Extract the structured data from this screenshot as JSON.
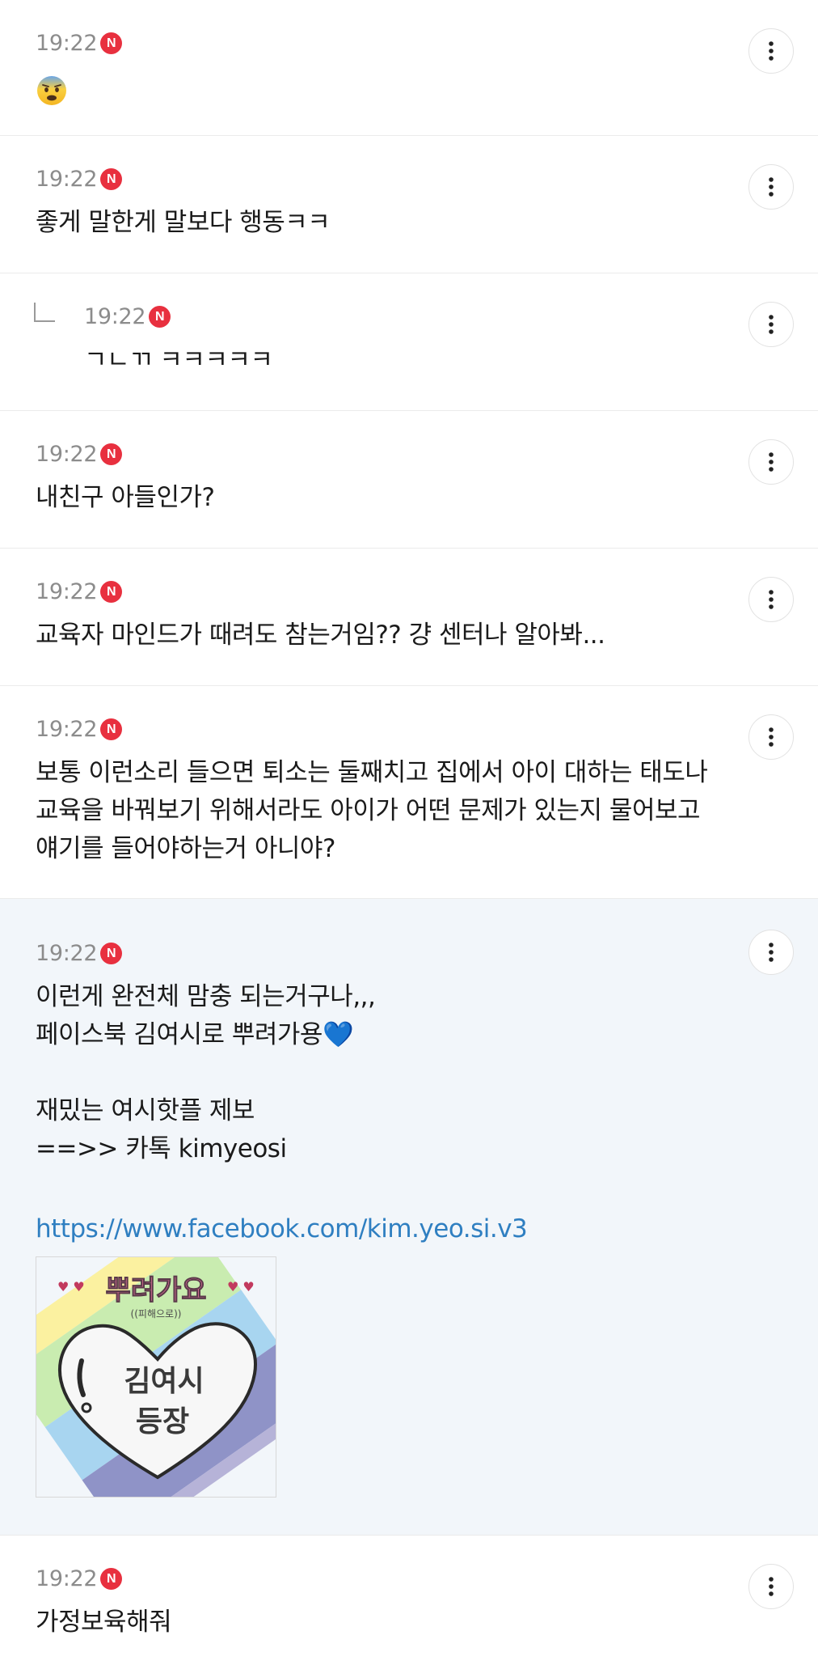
{
  "comments": [
    {
      "time": "19:22",
      "badge": "N",
      "text": "😨"
    },
    {
      "time": "19:22",
      "badge": "N",
      "text": "좋게 말한게 말보다 행동ㅋㅋ"
    },
    {
      "time": "19:22",
      "badge": "N",
      "text": "ㄱㄴㄲ ㅋㅋㅋㅋㅋ",
      "is_reply": true
    },
    {
      "time": "19:22",
      "badge": "N",
      "text": "내친구 아들인가?"
    },
    {
      "time": "19:22",
      "badge": "N",
      "text": "교육자 마인드가 때려도 참는거임?? 걍 센터나 알아봐..."
    },
    {
      "time": "19:22",
      "badge": "N",
      "text": "보통 이런소리 들으면 퇴소는 둘째치고 집에서 아이 대하는 태도나\n교육을 바꿔보기 위해서라도 아이가 어떤 문제가 있는지 물어보고\n얘기를 들어야하는거 아니야?"
    },
    {
      "time": "19:22",
      "badge": "N",
      "text": "이런게 완전체 맘충 되는거구나,,,\n페이스북 김여시로 뿌려가용💙\n\n재밌는 여시핫플 제보\n==>> 카톡 kimyeosi",
      "link": "https://www.facebook.com/kim.yeo.si.v3",
      "sticker": {
        "title": "뿌려가요",
        "subtitle": "((피해으로))",
        "line1": "김여시",
        "line2": "등장"
      }
    },
    {
      "time": "19:22",
      "badge": "N",
      "text": "가정보육해줘"
    }
  ],
  "colors": {
    "accent_badge": "#e8303f",
    "link": "#2f7fc1",
    "highlight_bg": "#f2f6fa",
    "heart": "#3fa9f5"
  },
  "icons": {
    "more": "more-vertical-icon",
    "new": "new-badge-icon",
    "reply": "reply-arrow-icon"
  }
}
